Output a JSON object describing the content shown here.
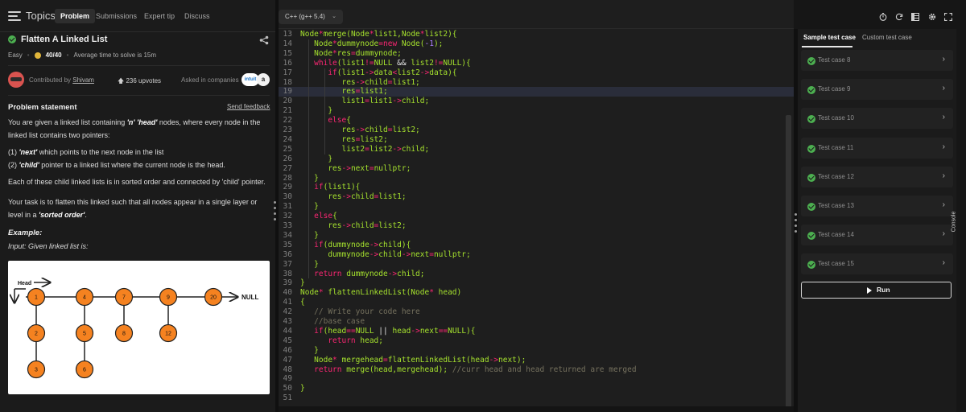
{
  "nav": {
    "topics": "Topics",
    "tabs": [
      "Problem",
      "Submissions",
      "Expert tip",
      "Discuss"
    ]
  },
  "question": {
    "title": "Flatten A Linked List",
    "difficulty": "Easy",
    "score": "40/40",
    "avg_time": "Average time to solve is 15m",
    "contributed_by": "Contributed by",
    "contributor": "Shivam",
    "upvotes": "236 upvotes",
    "asked_in": "Asked in companies",
    "company_logos": [
      "intuit",
      "a"
    ]
  },
  "statement": {
    "heading": "Problem statement",
    "send_feedback": "Send feedback",
    "p1_a": "You are given a linked list containing ",
    "p1_b": "'n' 'head'",
    "p1_c": " nodes, where every node in the linked list contains two pointers:",
    "p2_a": "(1) ",
    "p2_b": "'next'",
    "p2_c": " which points to the next node in the list",
    "p3_a": "(2) ",
    "p3_b": "'child'",
    "p3_c": " pointer to a linked list where the current node is the head.",
    "p4": "Each of these child linked lists is in sorted order and connected by 'child' pointer.",
    "p5_a": "Your task is to flatten this linked such that all nodes appear in a single layer or level in a ",
    "p5_b": "'sorted order'",
    "p5_c": ".",
    "example": "Example:",
    "input": "Input: Given linked list is:"
  },
  "diagram": {
    "head_label": "Head",
    "null_label": "NULL",
    "node_color": "#f58220",
    "top_row": [
      "1",
      "4",
      "7",
      "9",
      "20"
    ],
    "children": [
      [
        "2",
        "3"
      ],
      [
        "5",
        "6"
      ],
      [
        "8"
      ],
      [
        "12"
      ],
      []
    ]
  },
  "editor": {
    "language": "C++ (g++ 5.4)",
    "lines": [
      {
        "n": "13",
        "t": [
          [
            "Node",
            ""
          ],
          [
            "*",
            "k"
          ],
          [
            "merge(Node",
            ""
          ],
          [
            "*",
            "k"
          ],
          [
            "list1,Node",
            ""
          ],
          [
            "*",
            "k"
          ],
          [
            "list2){",
            ""
          ]
        ]
      },
      {
        "n": "14",
        "t": [
          [
            "   Node",
            ""
          ],
          [
            "*",
            "k"
          ],
          [
            "dummynode",
            ""
          ],
          [
            "=",
            "k"
          ],
          [
            "new",
            "k"
          ],
          [
            " Node(",
            ""
          ],
          [
            "-1",
            "n"
          ],
          [
            ");",
            ""
          ]
        ]
      },
      {
        "n": "15",
        "t": [
          [
            "   Node",
            ""
          ],
          [
            "*",
            "k"
          ],
          [
            "res",
            ""
          ],
          [
            "=",
            "k"
          ],
          [
            "dummynode;",
            ""
          ]
        ]
      },
      {
        "n": "16",
        "t": [
          [
            "   ",
            ""
          ],
          [
            "while",
            "k"
          ],
          [
            "(list1",
            ""
          ],
          [
            "!=",
            "k"
          ],
          [
            "NULL ",
            ""
          ],
          [
            "&&",
            "p"
          ],
          [
            " list2",
            ""
          ],
          [
            "!=",
            "k"
          ],
          [
            "NULL){",
            ""
          ]
        ]
      },
      {
        "n": "17",
        "t": [
          [
            "      ",
            ""
          ],
          [
            "if",
            "k"
          ],
          [
            "(list1",
            ""
          ],
          [
            "->",
            "k"
          ],
          [
            "data",
            ""
          ],
          [
            "<",
            "k"
          ],
          [
            "list2",
            ""
          ],
          [
            "->",
            "k"
          ],
          [
            "data){",
            ""
          ]
        ]
      },
      {
        "n": "18",
        "t": [
          [
            "         res",
            ""
          ],
          [
            "->",
            "k"
          ],
          [
            "child",
            ""
          ],
          [
            "=",
            "k"
          ],
          [
            "list1;",
            ""
          ]
        ]
      },
      {
        "n": "19",
        "t": [
          [
            "         res",
            ""
          ],
          [
            "=",
            "k"
          ],
          [
            "list1;",
            ""
          ]
        ]
      },
      {
        "n": "20",
        "t": [
          [
            "         list1",
            ""
          ],
          [
            "=",
            "k"
          ],
          [
            "list1",
            ""
          ],
          [
            "->",
            "k"
          ],
          [
            "child;",
            ""
          ]
        ]
      },
      {
        "n": "21",
        "t": [
          [
            "      }",
            ""
          ]
        ]
      },
      {
        "n": "22",
        "t": [
          [
            "      ",
            ""
          ],
          [
            "else",
            "k"
          ],
          [
            "{",
            ""
          ]
        ]
      },
      {
        "n": "23",
        "t": [
          [
            "         res",
            ""
          ],
          [
            "->",
            "k"
          ],
          [
            "child",
            ""
          ],
          [
            "=",
            "k"
          ],
          [
            "list2;",
            ""
          ]
        ]
      },
      {
        "n": "24",
        "t": [
          [
            "         res",
            ""
          ],
          [
            "=",
            "k"
          ],
          [
            "list2;",
            ""
          ]
        ]
      },
      {
        "n": "25",
        "t": [
          [
            "         list2",
            ""
          ],
          [
            "=",
            "k"
          ],
          [
            "list2",
            ""
          ],
          [
            "->",
            "k"
          ],
          [
            "child;",
            ""
          ]
        ]
      },
      {
        "n": "26",
        "t": [
          [
            "      }",
            ""
          ]
        ]
      },
      {
        "n": "27",
        "t": [
          [
            "      res",
            ""
          ],
          [
            "->",
            "k"
          ],
          [
            "next",
            ""
          ],
          [
            "=",
            "k"
          ],
          [
            "nullptr;",
            ""
          ]
        ]
      },
      {
        "n": "28",
        "t": [
          [
            "   }",
            ""
          ]
        ]
      },
      {
        "n": "29",
        "t": [
          [
            "   ",
            ""
          ],
          [
            "if",
            "k"
          ],
          [
            "(list1){",
            ""
          ]
        ]
      },
      {
        "n": "30",
        "t": [
          [
            "      res",
            ""
          ],
          [
            "->",
            "k"
          ],
          [
            "child",
            ""
          ],
          [
            "=",
            "k"
          ],
          [
            "list1;",
            ""
          ]
        ]
      },
      {
        "n": "31",
        "t": [
          [
            "   }",
            ""
          ]
        ]
      },
      {
        "n": "32",
        "t": [
          [
            "   ",
            ""
          ],
          [
            "else",
            "k"
          ],
          [
            "{",
            ""
          ]
        ]
      },
      {
        "n": "33",
        "t": [
          [
            "      res",
            ""
          ],
          [
            "->",
            "k"
          ],
          [
            "child",
            ""
          ],
          [
            "=",
            "k"
          ],
          [
            "list2;",
            ""
          ]
        ]
      },
      {
        "n": "34",
        "t": [
          [
            "   }",
            ""
          ]
        ]
      },
      {
        "n": "35",
        "t": [
          [
            "   ",
            ""
          ],
          [
            "if",
            "k"
          ],
          [
            "(dummynode",
            ""
          ],
          [
            "->",
            "k"
          ],
          [
            "child){",
            ""
          ]
        ]
      },
      {
        "n": "36",
        "t": [
          [
            "      dummynode",
            ""
          ],
          [
            "->",
            "k"
          ],
          [
            "child",
            ""
          ],
          [
            "->",
            "k"
          ],
          [
            "next",
            ""
          ],
          [
            "=",
            "k"
          ],
          [
            "nullptr;",
            ""
          ]
        ]
      },
      {
        "n": "37",
        "t": [
          [
            "   }",
            ""
          ]
        ]
      },
      {
        "n": "38",
        "t": [
          [
            "   ",
            ""
          ],
          [
            "return",
            "k"
          ],
          [
            " dummynode",
            ""
          ],
          [
            "->",
            "k"
          ],
          [
            "child;",
            ""
          ]
        ]
      },
      {
        "n": "39",
        "t": [
          [
            "}",
            ""
          ]
        ]
      },
      {
        "n": "40",
        "t": [
          [
            "Node",
            ""
          ],
          [
            "*",
            "k"
          ],
          [
            " flattenLinkedList(Node",
            ""
          ],
          [
            "*",
            "k"
          ],
          [
            " head)",
            ""
          ]
        ]
      },
      {
        "n": "41",
        "t": [
          [
            "{",
            ""
          ]
        ]
      },
      {
        "n": "42",
        "t": [
          [
            "   ",
            ""
          ],
          [
            "// Write your code here",
            "c"
          ]
        ]
      },
      {
        "n": "43",
        "t": [
          [
            "   ",
            ""
          ],
          [
            "//base case",
            "c"
          ]
        ]
      },
      {
        "n": "44",
        "t": [
          [
            "   ",
            ""
          ],
          [
            "if",
            "k"
          ],
          [
            "(head",
            ""
          ],
          [
            "==",
            "k"
          ],
          [
            "NULL ",
            ""
          ],
          [
            "||",
            "p"
          ],
          [
            " head",
            ""
          ],
          [
            "->",
            "k"
          ],
          [
            "next",
            ""
          ],
          [
            "==",
            "k"
          ],
          [
            "NULL){",
            ""
          ]
        ]
      },
      {
        "n": "45",
        "t": [
          [
            "      ",
            ""
          ],
          [
            "return",
            "k"
          ],
          [
            " head;",
            ""
          ]
        ]
      },
      {
        "n": "46",
        "t": [
          [
            "   }",
            ""
          ]
        ]
      },
      {
        "n": "47",
        "t": [
          [
            "   Node",
            ""
          ],
          [
            "*",
            "k"
          ],
          [
            " mergehead",
            ""
          ],
          [
            "=",
            "k"
          ],
          [
            "flattenLinkedList(head",
            ""
          ],
          [
            "->",
            "k"
          ],
          [
            "next);",
            ""
          ]
        ]
      },
      {
        "n": "48",
        "t": [
          [
            "   ",
            ""
          ],
          [
            "return",
            "k"
          ],
          [
            " merge(head,mergehead); ",
            ""
          ],
          [
            "//curr head and head returned are merged",
            "c"
          ]
        ]
      },
      {
        "n": "49",
        "t": [
          [
            "",
            ""
          ]
        ]
      },
      {
        "n": "50",
        "t": [
          [
            "}",
            ""
          ]
        ]
      },
      {
        "n": "51",
        "t": [
          [
            "",
            ""
          ]
        ]
      }
    ]
  },
  "right_panel": {
    "tabs": [
      "Sample test case",
      "Custom test case"
    ],
    "test_cases": [
      "Test case 8",
      "Test case 9",
      "Test case 10",
      "Test case 11",
      "Test case 12",
      "Test case 13",
      "Test case 14",
      "Test case 15"
    ],
    "run_label": "Run",
    "console_label": "Console"
  }
}
